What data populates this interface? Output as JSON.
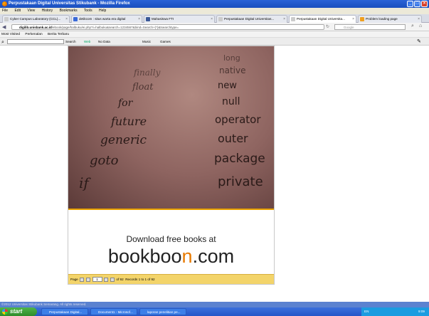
{
  "window": {
    "title": "Perpustakaan Digital Universitas Stikubank - Mozilla Firefox",
    "controls": [
      "_",
      "□",
      "×"
    ]
  },
  "menubar": [
    "File",
    "Edit",
    "View",
    "History",
    "Bookmarks",
    "Tools",
    "Help"
  ],
  "tabs": [
    {
      "label": "Cyber Campus Laboratory (CCL)...",
      "active": false
    },
    {
      "label": "detikcom : situs warta era digital",
      "active": false
    },
    {
      "label": "Mahasiswa FTI",
      "active": false
    },
    {
      "label": "Perpustakaan Digital Universitas...",
      "active": false
    },
    {
      "label": "Perpustakaan Digital Universita...",
      "active": true
    },
    {
      "label": "Problem loading page",
      "active": false
    }
  ],
  "nav": {
    "url_domain": "digilib.unisbank.ac.id",
    "url_rest": "/ebook/page/halbuku/ei.php?i=halbuku&search=1234567&bind=Search+(*)&tsearchtype=",
    "search_placeholder": "Google"
  },
  "bookmarks": [
    "Most Visited",
    "Perkenalan",
    "Berita Terbaru"
  ],
  "toolbar": {
    "items": [
      "Search",
      "Web",
      "No Data",
      "Music",
      "Games"
    ]
  },
  "book": {
    "words_left": [
      "finally",
      "float",
      "for",
      "future",
      "generic",
      "goto",
      "if"
    ],
    "words_right": [
      "long",
      "native",
      "new",
      "null",
      "operator",
      "outer",
      "package",
      "private"
    ],
    "ad_line": "Download free books at",
    "brand_pre": "bookboo",
    "brand_o": "n",
    "brand_post": ".com"
  },
  "pager": {
    "page_label": "Page",
    "page_value": "1",
    "of_label": "of 92",
    "records": "Records 1 to 1 of 92"
  },
  "statusbar": {
    "text": "©2012 Universitas Stikubank Semarang. All rights reserved."
  },
  "taskbar": {
    "start": "start",
    "tasks": [
      "Perpustakaan Digital...",
      "Document1 - Microsof...",
      "laporan penelitian pe..."
    ],
    "lang": "EN",
    "clock": "9:09"
  }
}
